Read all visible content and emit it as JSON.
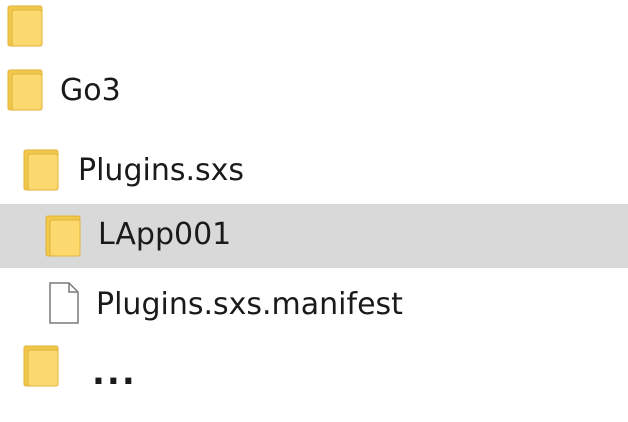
{
  "colors": {
    "folder_fill": "#fbd96e",
    "folder_back": "#f2c84b",
    "folder_edge": "#e0b23a",
    "file_fill": "#ffffff",
    "file_edge": "#7a7a7a",
    "selection": "#d9d9d9",
    "text": "#1a1a1a"
  },
  "tree": {
    "items": [
      {
        "label": "",
        "icon": "folder-icon",
        "depth": 0,
        "selected": false
      },
      {
        "label": "Go3",
        "icon": "folder-icon",
        "depth": 0,
        "selected": false
      },
      {
        "label": "Plugins.sxs",
        "icon": "folder-icon",
        "depth": 1,
        "selected": false
      },
      {
        "label": "LApp001",
        "icon": "folder-icon",
        "depth": 2,
        "selected": true
      },
      {
        "label": "Plugins.sxs.manifest",
        "icon": "file-icon",
        "depth": 2,
        "selected": false
      },
      {
        "label": "...",
        "icon": "folder-icon",
        "depth": 1,
        "selected": false
      }
    ]
  }
}
